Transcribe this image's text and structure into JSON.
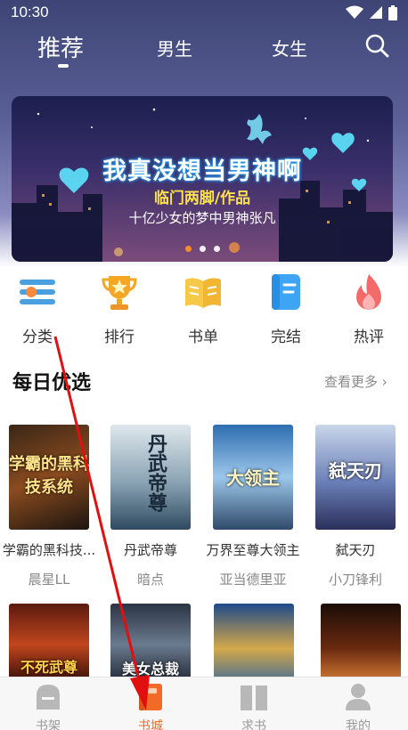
{
  "status_bar": {
    "time": "10:30"
  },
  "top_tabs": {
    "items": [
      {
        "label": "推荐",
        "active": true
      },
      {
        "label": "男生",
        "active": false
      },
      {
        "label": "女生",
        "active": false
      }
    ],
    "search_icon": "search-icon"
  },
  "banner": {
    "title": "我真没想当男神啊",
    "author": "临门两脚/作品",
    "subtitle": "十亿少女的梦中男神张凡",
    "dots": 3,
    "active_dot": 0
  },
  "categories": [
    {
      "label": "分类",
      "icon": "category-icon",
      "color": "#4a9fe0"
    },
    {
      "label": "排行",
      "icon": "trophy-icon",
      "color": "#f5a623"
    },
    {
      "label": "书单",
      "icon": "book-open-icon",
      "color": "#f7c948"
    },
    {
      "label": "完结",
      "icon": "notebook-icon",
      "color": "#3da5f4"
    },
    {
      "label": "热评",
      "icon": "flame-icon",
      "color": "#f26a6a"
    }
  ],
  "daily_picks": {
    "title": "每日优选",
    "more_label": "查看更多",
    "books": [
      {
        "title": "学霸的黑科技...",
        "author": "晨星LL",
        "cover_text": "学霸的黑科技系统"
      },
      {
        "title": "丹武帝尊",
        "author": "暗点",
        "cover_text": "丹武帝尊"
      },
      {
        "title": "万界至尊大领主",
        "author": "亚当德里亚",
        "cover_text": "大领主"
      },
      {
        "title": "弑天刃",
        "author": "小刀锋利",
        "cover_text": "弑天刃"
      }
    ],
    "row2_covers": [
      {
        "cover_text": "不死武尊"
      },
      {
        "cover_text": "美女总裁"
      },
      {
        "cover_text": ""
      },
      {
        "cover_text": ""
      }
    ]
  },
  "bottom_nav": [
    {
      "label": "书架",
      "icon": "bookshelf-icon",
      "active": false
    },
    {
      "label": "书城",
      "icon": "bookstore-icon",
      "active": true
    },
    {
      "label": "求书",
      "icon": "request-book-icon",
      "active": false
    },
    {
      "label": "我的",
      "icon": "profile-icon",
      "active": false
    }
  ],
  "colors": {
    "accent": "#f26b26",
    "header_bg": "#4a5088",
    "arrow": "#e01010"
  }
}
